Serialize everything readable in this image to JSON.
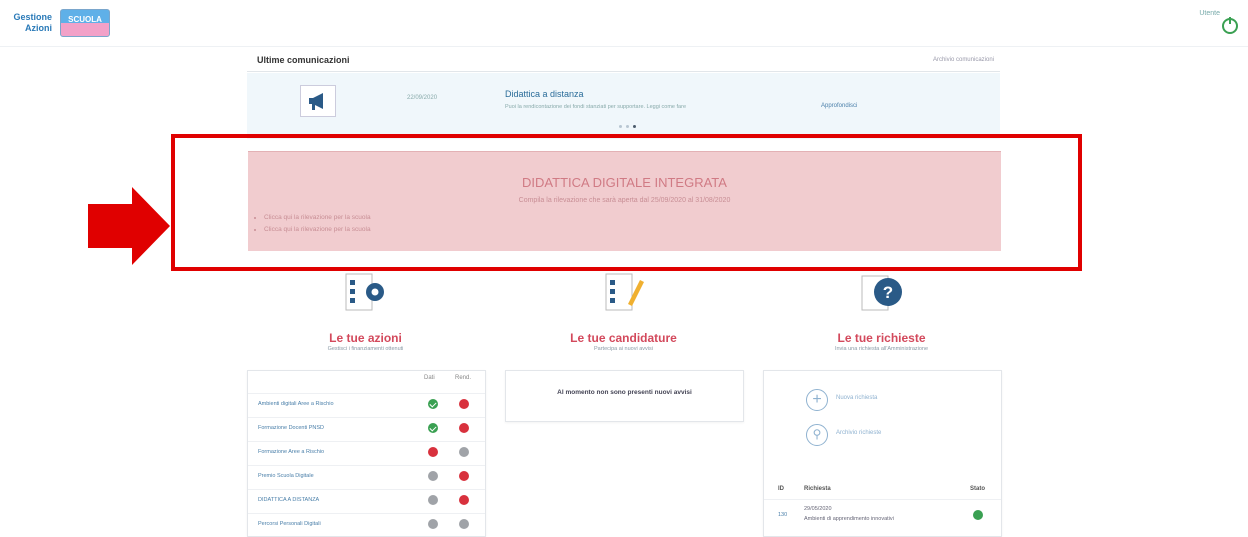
{
  "header": {
    "brand_line1": "Gestione",
    "brand_line2": "Azioni",
    "logo_text": "SCUOLA",
    "user_label": "Utente"
  },
  "communications": {
    "title": "Ultime comunicazioni",
    "archive_link": "Archivio comunicazioni",
    "item": {
      "date": "22/09/2020",
      "title": "Didattica a distanza",
      "description": "Puoi la rendicontazione dei fondi stanziati per supportare. Leggi come fare",
      "link": "Approfondisci"
    }
  },
  "ddi_banner": {
    "title": "DIDATTICA DIGITALE INTEGRATA",
    "subtitle": "Compila la rilevazione che sarà aperta dal 25/09/2020 al 31/08/2020",
    "links": [
      "Clicca qui la rilevazione per la scuola",
      "Clicca qui la rilevazione per la scuola"
    ]
  },
  "columns": {
    "actions": {
      "title": "Le tue azioni",
      "subtitle": "Gestisci i finanziamenti ottenuti",
      "col_dati": "Dati",
      "col_rend": "Rend.",
      "rows": [
        {
          "name": "Ambienti digitali Aree a Rischio"
        },
        {
          "name": "Formazione Docenti PNSD"
        },
        {
          "name": "Formazione Aree a Rischio"
        },
        {
          "name": "Premio Scuola Digitale"
        },
        {
          "name": "DIDATTICA A DISTANZA"
        },
        {
          "name": "Percorsi Personali Digitali"
        }
      ]
    },
    "candidature": {
      "title": "Le tue candidature",
      "subtitle": "Partecipa ai nuovi avvisi",
      "empty": "Al momento non sono presenti nuovi avvisi"
    },
    "requests": {
      "title": "Le tue richieste",
      "subtitle": "Invia una richiesta all'Amministrazione",
      "new_label": "Nuova richiesta",
      "archive_label": "Archivio richieste",
      "col_id": "ID",
      "col_req": "Richiesta",
      "col_state": "Stato",
      "row": {
        "id": "130",
        "date": "29/05/2020",
        "text": "Ambienti di apprendimento innovativi"
      }
    }
  },
  "colors": {
    "accent_red": "#d3495c",
    "highlight_red": "#e00000",
    "status_green": "#3aa052",
    "status_red": "#d8313d",
    "status_grey": "#a0a3a8"
  }
}
